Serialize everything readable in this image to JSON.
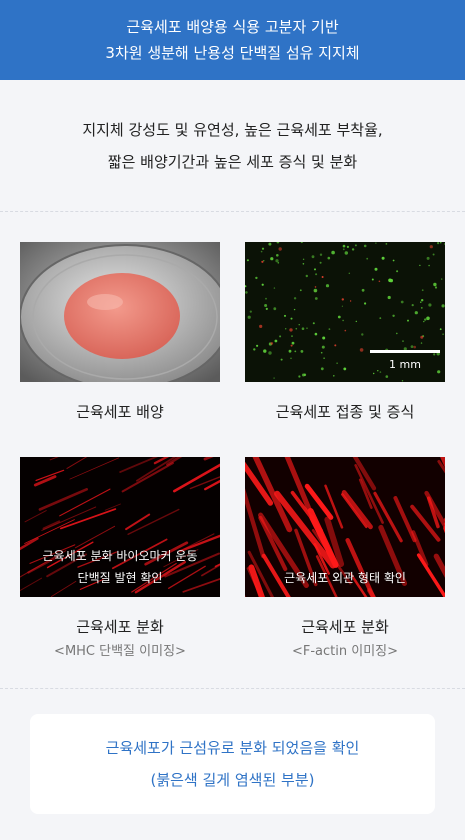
{
  "header": {
    "line1": "근육세포 배양용 식용 고분자 기반",
    "line2": "3차원 생분해 난용성 단백질 섬유 지지체"
  },
  "summary": {
    "line1": "지지체 강성도 및 유연성, 높은 근육세포 부착율,",
    "line2": "짧은 배양기간과 높은 세포 증식 및 분화"
  },
  "panels": [
    {
      "title": "근육세포 배양"
    },
    {
      "title": "근육세포 접종 및 증식",
      "scale_label": "1 mm"
    },
    {
      "title": "근육세포 분화",
      "subtitle": "<MHC 단백질 이미징>",
      "overlay_line1": "근육세포 분화 바이오마커 운동",
      "overlay_line2": "단백질 발현 확인"
    },
    {
      "title": "근육세포 분화",
      "subtitle": "<F-actin 이미징>",
      "overlay_line1": "근육세포 외관 형태 확인"
    }
  ],
  "note": {
    "line1": "근육세포가 근섬유로 분화 되었음을 확인",
    "line2": "(붉은색 길게 염색된 부분)"
  },
  "colors": {
    "header_bg": "#2f73c6",
    "accent_text": "#2f73c6",
    "page_bg": "#f4f5f8"
  }
}
